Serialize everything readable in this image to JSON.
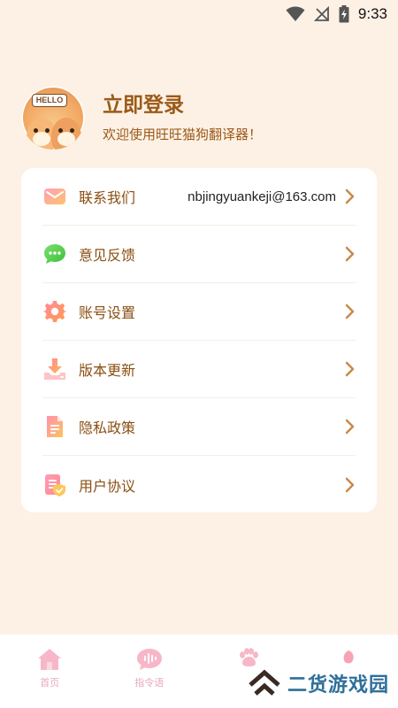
{
  "status_bar": {
    "time": "9:33"
  },
  "profile": {
    "avatar_sign": "HELLO",
    "login_title": "立即登录",
    "welcome_text": "欢迎使用旺旺猫狗翻译器！"
  },
  "menu": {
    "items": [
      {
        "label": "联系我们",
        "value": "nbjingyuankeji@163.com",
        "icon": "mail-icon"
      },
      {
        "label": "意见反馈",
        "value": "",
        "icon": "chat-bubble-icon"
      },
      {
        "label": "账号设置",
        "value": "",
        "icon": "gear-icon"
      },
      {
        "label": "版本更新",
        "value": "",
        "icon": "download-icon"
      },
      {
        "label": "隐私政策",
        "value": "",
        "icon": "document-icon"
      },
      {
        "label": "用户协议",
        "value": "",
        "icon": "agreement-icon"
      }
    ]
  },
  "tab_bar": {
    "tabs": [
      {
        "label": "首页",
        "icon": "home-icon"
      },
      {
        "label": "指令语",
        "icon": "voice-message-icon"
      },
      {
        "label": "",
        "icon": "paw-icon"
      },
      {
        "label": "",
        "icon": "leaf-icon"
      }
    ]
  },
  "watermark": {
    "text": "二货游戏园"
  },
  "colors": {
    "background": "#fdf1e6",
    "accent_text": "#9b5a17",
    "tab_pink": "#e8a9bd"
  }
}
